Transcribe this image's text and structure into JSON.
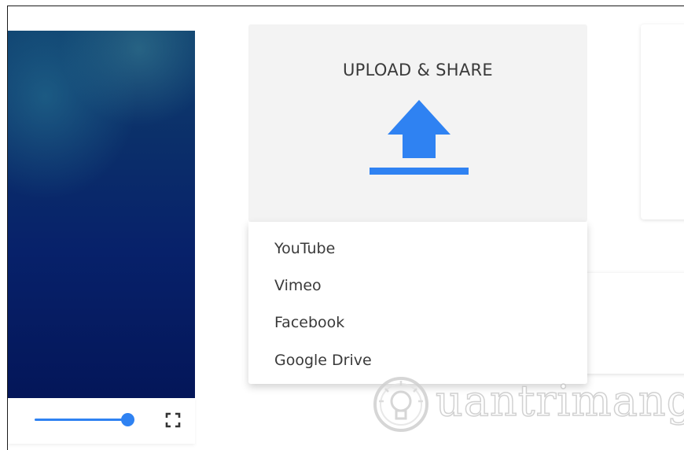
{
  "upload": {
    "title": "UPLOAD & SHARE",
    "icon": "upload-icon",
    "accent_color": "#2f82f2"
  },
  "share_menu": {
    "items": [
      "YouTube",
      "Vimeo",
      "Facebook",
      "Google Drive"
    ]
  },
  "player": {
    "volume_fraction": 1.0,
    "volume_icon": "volume-slider",
    "fullscreen_icon": "fullscreen-icon"
  },
  "watermark": {
    "text": "uantrimang",
    "logo_icon": "lightbulb-logo"
  }
}
